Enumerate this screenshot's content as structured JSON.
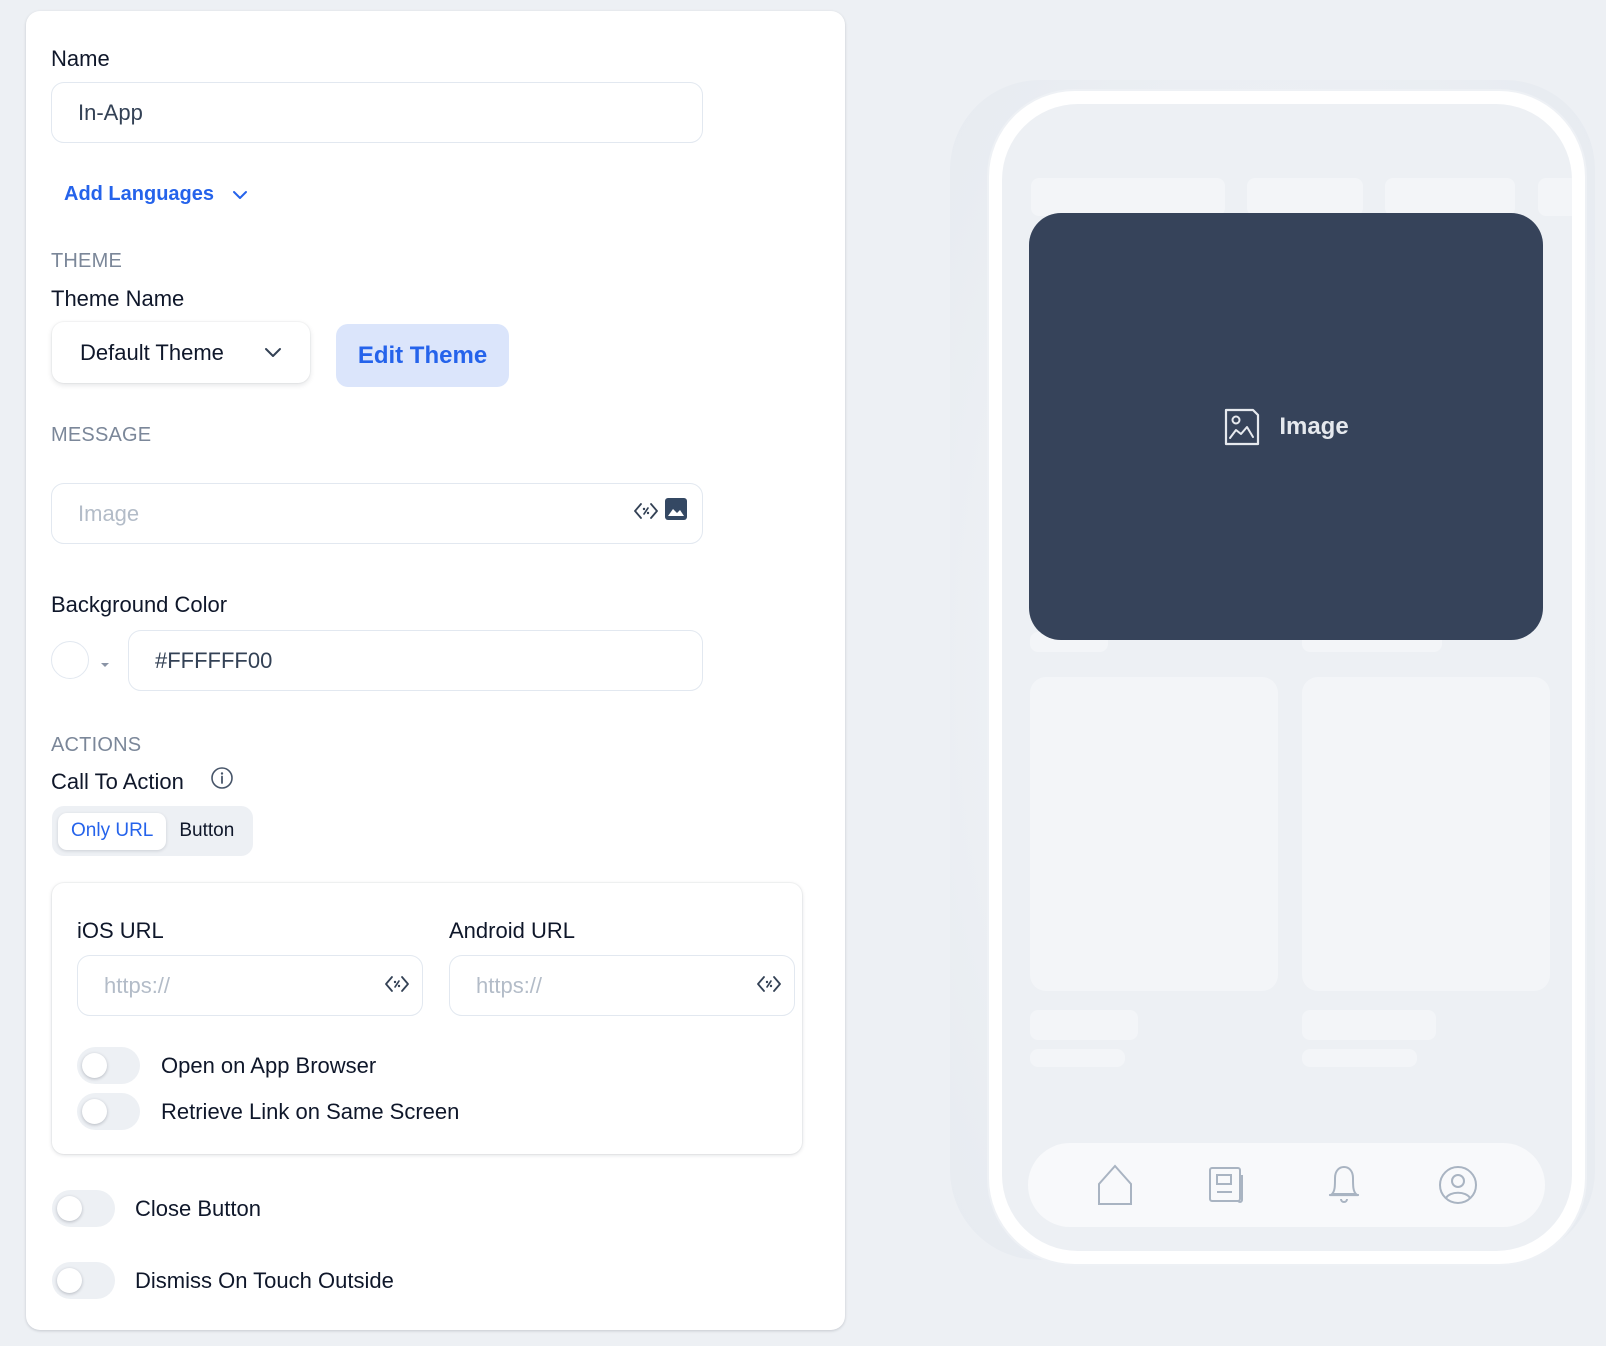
{
  "form": {
    "name": {
      "label": "Name",
      "value": "In-App"
    },
    "add_languages": {
      "label": "Add Languages",
      "icon": "chevron-down-icon"
    },
    "theme": {
      "section_title": "THEME",
      "theme_name_label": "Theme Name",
      "selected_theme": "Default Theme",
      "edit_button": "Edit Theme"
    },
    "message": {
      "section_title": "MESSAGE",
      "image_placeholder": "Image",
      "icons": [
        "code-variable-icon",
        "image-icon"
      ]
    },
    "background_color": {
      "label": "Background Color",
      "value": "#FFFFFF00",
      "swatch_color": "#ffffff"
    },
    "actions": {
      "section_title": "ACTIONS",
      "cta_label": "Call To Action",
      "info_icon": "info-icon",
      "cta_options": [
        "Only URL",
        "Button"
      ],
      "cta_selected": "Only URL",
      "ios_url": {
        "label": "iOS URL",
        "placeholder": "https://"
      },
      "android_url": {
        "label": "Android URL",
        "placeholder": "https://"
      },
      "toggles": [
        {
          "label": "Open on App Browser",
          "on": false
        },
        {
          "label": "Retrieve Link on Same Screen",
          "on": false
        }
      ]
    },
    "bottom_toggles": [
      {
        "label": "Close Button",
        "on": false
      },
      {
        "label": "Dismiss On Touch Outside",
        "on": false
      }
    ]
  },
  "preview": {
    "image_label": "Image",
    "image_bg_color": "#36435a",
    "tabbar_icons": [
      "home-icon",
      "news-icon",
      "bell-icon",
      "profile-icon"
    ]
  },
  "colors": {
    "accent": "#2563eb",
    "accent_soft": "#dbe5fb",
    "page_bg": "#edf0f4",
    "text_primary": "#0f172a",
    "text_muted": "#7b8799"
  }
}
